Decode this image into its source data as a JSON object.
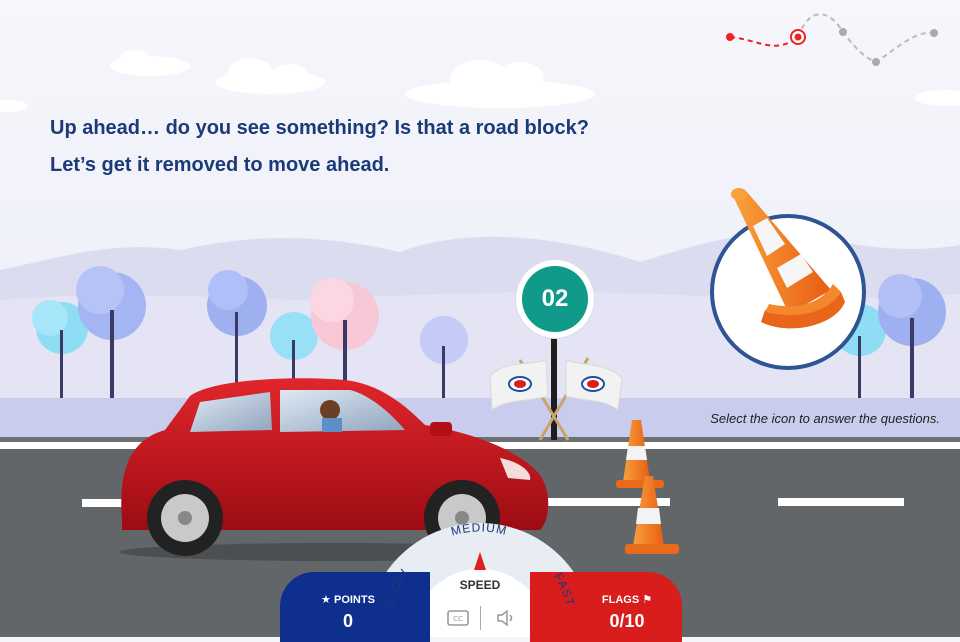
{
  "headline": {
    "line1": "Up ahead… do you see something? Is that a road block?",
    "line2": "Let’s get it removed to move ahead."
  },
  "instruction": "Select the icon to answer the questions.",
  "step_number": "02",
  "progress": {
    "completed_steps": 2,
    "total_steps": 5
  },
  "hud": {
    "points_label": "POINTS",
    "points_value": "0",
    "flags_label": "FLAGS",
    "flags_value": "0/10",
    "speed_label": "SPEED",
    "speed_options": {
      "slow": "SLOW",
      "medium": "MEDIUM",
      "fast": "FAST"
    },
    "selected_speed": "MEDIUM"
  },
  "icons": {
    "points": "star-icon",
    "flags": "flag-icon",
    "subtitles": "captions-icon",
    "audio": "speaker-icon",
    "answer": "traffic-cone-icon"
  },
  "colors": {
    "heading": "#1b3a78",
    "points_panel": "#0f2f8f",
    "flags_panel": "#d91c1c",
    "step_badge": "#0f9a8a",
    "car": "#c8141c",
    "cone": "#f47a20"
  }
}
